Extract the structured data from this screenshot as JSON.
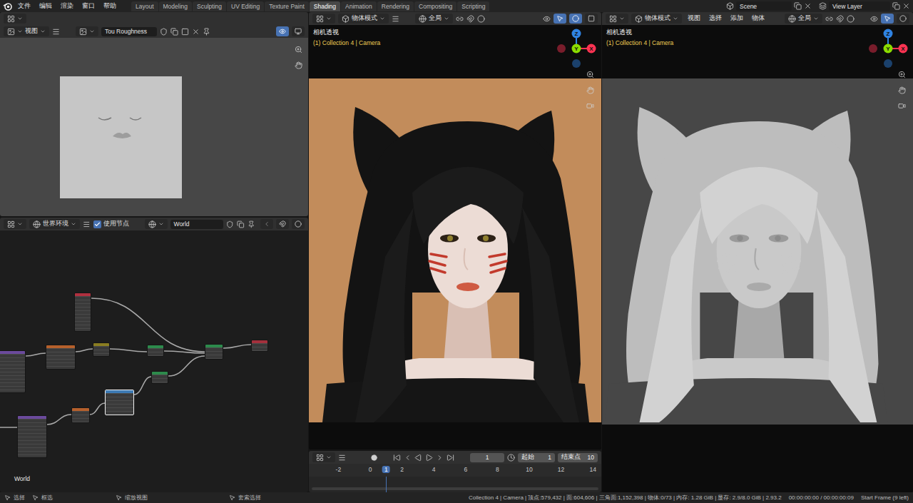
{
  "menu_bar": {
    "items": [
      "文件",
      "编辑",
      "渲染",
      "窗口",
      "帮助"
    ],
    "workspaces": [
      {
        "label": "Layout",
        "selected": false
      },
      {
        "label": "Modeling",
        "selected": false
      },
      {
        "label": "Sculpting",
        "selected": false
      },
      {
        "label": "UV Editing",
        "selected": false
      },
      {
        "label": "Texture Paint",
        "selected": false
      },
      {
        "label": "Shading",
        "selected": true
      },
      {
        "label": "Animation",
        "selected": false
      },
      {
        "label": "Rendering",
        "selected": false
      },
      {
        "label": "Compositing",
        "selected": false
      },
      {
        "label": "Scripting",
        "selected": false
      }
    ],
    "scene": "Scene",
    "view_layer": "View Layer"
  },
  "image_editor": {
    "view_menu": "视图",
    "image_name": "Tou Roughness"
  },
  "node_editor": {
    "shader_type": "世界环境",
    "use_nodes": {
      "label": "使用节点",
      "checked": true
    },
    "world": "World",
    "frame_label": "World",
    "nodes": [
      {
        "color": "#b0303f",
        "selected": false
      },
      {
        "color": "#6b4a9c",
        "selected": false
      },
      {
        "color": "#b5602c",
        "selected": false
      },
      {
        "color": "#8a7d22",
        "selected": false
      },
      {
        "color": "#2d8a4c",
        "selected": false
      },
      {
        "color": "#2d8a4c",
        "selected": false
      },
      {
        "color": "#a3303c",
        "selected": false
      },
      {
        "color": "#2d8a4c",
        "selected": false
      },
      {
        "color": "#3d7ab3",
        "selected": true
      },
      {
        "color": "#b5602c",
        "selected": false
      },
      {
        "color": "#6b4a9c",
        "selected": false
      }
    ]
  },
  "viewport_render": {
    "mode": "物体模式",
    "orientation": "全局",
    "view_label": "相机透视",
    "object_label": "(1) Collection 4 | Camera"
  },
  "viewport_solid": {
    "mode": "物体模式",
    "menus": [
      "视图",
      "选择",
      "添加",
      "物体"
    ],
    "orientation": "全局",
    "view_label": "相机透视",
    "object_label": "(1) Collection 4 | Camera"
  },
  "gizmo_axes": [
    {
      "label": "Z",
      "color": "#2f83e3"
    },
    {
      "label": "Y",
      "color": "#8bdc00"
    },
    {
      "label": "X",
      "color": "#ff3352"
    }
  ],
  "timeline": {
    "current_frame": "1",
    "start_label": "起始",
    "start": "1",
    "end_label": "结束点",
    "end": "10",
    "ticks": [
      {
        "label": "-2",
        "selected": false
      },
      {
        "label": "0",
        "selected": false
      },
      {
        "label": "1",
        "selected": true
      },
      {
        "label": "2",
        "selected": false
      },
      {
        "label": "4",
        "selected": false
      },
      {
        "label": "6",
        "selected": false
      },
      {
        "label": "8",
        "selected": false
      },
      {
        "label": "10",
        "selected": false
      },
      {
        "label": "12",
        "selected": false
      },
      {
        "label": "14",
        "selected": false
      }
    ]
  },
  "status_bar": {
    "hints": [
      "选择",
      "框选",
      "缩放视图",
      "套索选择"
    ],
    "stats": "Collection 4 | Camera | 顶点:579,432 | 面:604,606 | 三角面:1,152,398 | 物体:0/73 | 内存: 1.28 GiB | 显存: 2.9/8.0 GiB | 2.93.2",
    "time": "00:00:00:00 / 00:00:00:09",
    "message": "Start Frame (9 left)"
  }
}
